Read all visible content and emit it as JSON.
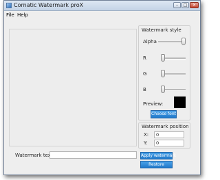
{
  "window": {
    "title": "Cornatic Watermark proX"
  },
  "titlebar_buttons": {
    "minimize": "–",
    "maximize": "□",
    "close": "✕"
  },
  "menu": {
    "items": [
      "File",
      "Help"
    ]
  },
  "watermark_style": {
    "title": "Watermark style",
    "alpha": {
      "label": "Alpha",
      "value": 1.0
    },
    "r": {
      "label": "R",
      "value": 0.0
    },
    "g": {
      "label": "G",
      "value": 0.0
    },
    "b": {
      "label": "B",
      "value": 0.0
    },
    "preview_label": "Preview:",
    "preview_color": "#000000",
    "choose_font_label": "Choose font"
  },
  "watermark_position": {
    "title": "Watermark position",
    "x_label": "X:",
    "x_value": "0",
    "y_label": "Y:",
    "y_value": "0"
  },
  "watermark_text": {
    "label": "Watermark text:",
    "value": ""
  },
  "actions": {
    "apply_label": "Apply watermark",
    "restore_label": "Restore"
  },
  "colors": {
    "button": "#2f8ad8",
    "window_bg": "#eeeeee"
  }
}
